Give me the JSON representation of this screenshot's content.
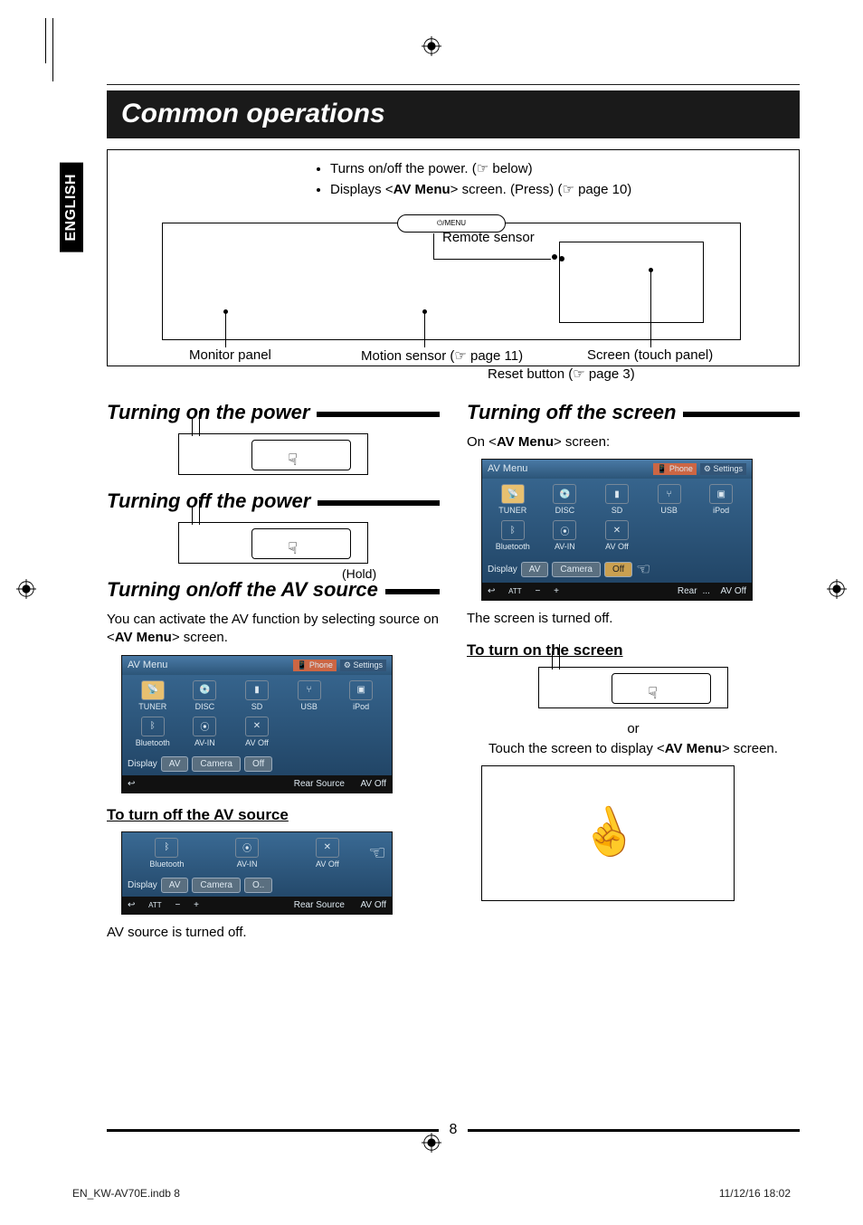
{
  "lang_tab": "ENGLISH",
  "section_title": "Common operations",
  "device": {
    "bullet1_pre": "Turns on/off the power. (",
    "bullet1_ref": "☞",
    "bullet1_post": " below)",
    "bullet2_pre": "Displays <",
    "bullet2_bold": "AV Menu",
    "bullet2_mid": "> screen. (Press) (",
    "bullet2_ref": "☞",
    "bullet2_post": " page 10)",
    "pill_label": "⏻/MENU",
    "remote_sensor": "Remote sensor",
    "monitor_panel": "Monitor panel",
    "motion_sensor_pre": "Motion sensor (",
    "motion_sensor_ref": "☞",
    "motion_sensor_post": " page 11)",
    "screen_touch": "Screen (touch panel)",
    "reset_pre": "Reset button (",
    "reset_ref": "☞",
    "reset_post": " page 3)"
  },
  "left": {
    "h_on": "Turning on the power",
    "h_off": "Turning off the power",
    "hold": "(Hold)",
    "h_av": "Turning on/off the AV source",
    "av_intro_pre": "You can activate the AV function by selecting source on <",
    "av_intro_bold": "AV Menu",
    "av_intro_post": "> screen.",
    "sub_av_off": "To turn off the AV source",
    "av_off_result": "AV source is turned off."
  },
  "right": {
    "h_screen_off": "Turning off the screen",
    "on_menu_pre": "On <",
    "on_menu_bold": "AV Menu",
    "on_menu_post": "> screen:",
    "screen_off_result": "The screen is turned off.",
    "sub_screen_on": "To turn on the screen",
    "or": "or",
    "touch_pre": "Touch the screen to display <",
    "touch_bold": "AV Menu",
    "touch_post": "> screen."
  },
  "shot": {
    "title": "AV Menu",
    "phone": "Phone",
    "settings": "Settings",
    "sources": [
      "TUNER",
      "DISC",
      "SD",
      "USB",
      "iPod",
      "Bluetooth",
      "AV-IN",
      "AV Off"
    ],
    "display": "Display",
    "av": "AV",
    "camera": "Camera",
    "off": "Off",
    "rear": "Rear",
    "rear_source": "Rear Source",
    "avoff": "AV Off",
    "att": "ATT",
    "back": "↩",
    "minus": "−",
    "plus": "+"
  },
  "page_number": "8",
  "footer_left": "EN_KW-AV70E.indb   8",
  "footer_right": "11/12/16   18:02"
}
